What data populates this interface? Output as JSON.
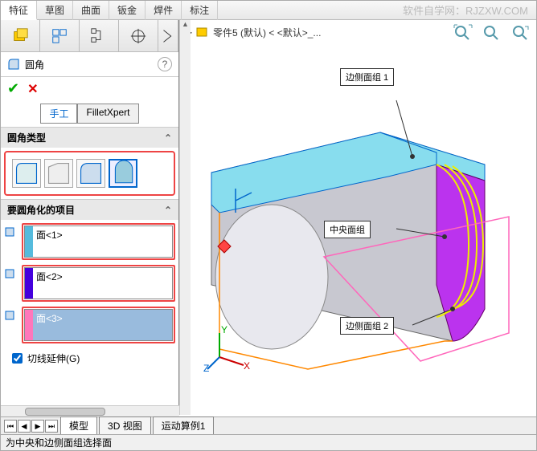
{
  "topbar": {
    "tabs": [
      "特征",
      "草图",
      "曲面",
      "钣金",
      "焊件",
      "标注"
    ],
    "active": 0
  },
  "watermark": "软件自学网：RJZXW.COM",
  "panel": {
    "title": "圆角",
    "mode_manual": "手工",
    "mode_xpert": "FilletXpert",
    "section_type": "圆角类型",
    "section_items": "要圆角化的项目",
    "faces": [
      {
        "label": "面<1>",
        "color": "#5bd"
      },
      {
        "label": "面<2>",
        "color": "#40d"
      },
      {
        "label": "面<3>",
        "color": "#f7b",
        "selected": true
      }
    ],
    "tangent_label": "切线延伸(G)"
  },
  "breadcrumb": "零件5 (默认) < <默认>_...",
  "labels3d": {
    "side1": "边侧面组 1",
    "center": "中央面组",
    "side2": "边侧面组 2"
  },
  "bottom_tabs": [
    "模型",
    "3D 视图",
    "运动算例1"
  ],
  "status": "为中央和边侧面组选择面"
}
